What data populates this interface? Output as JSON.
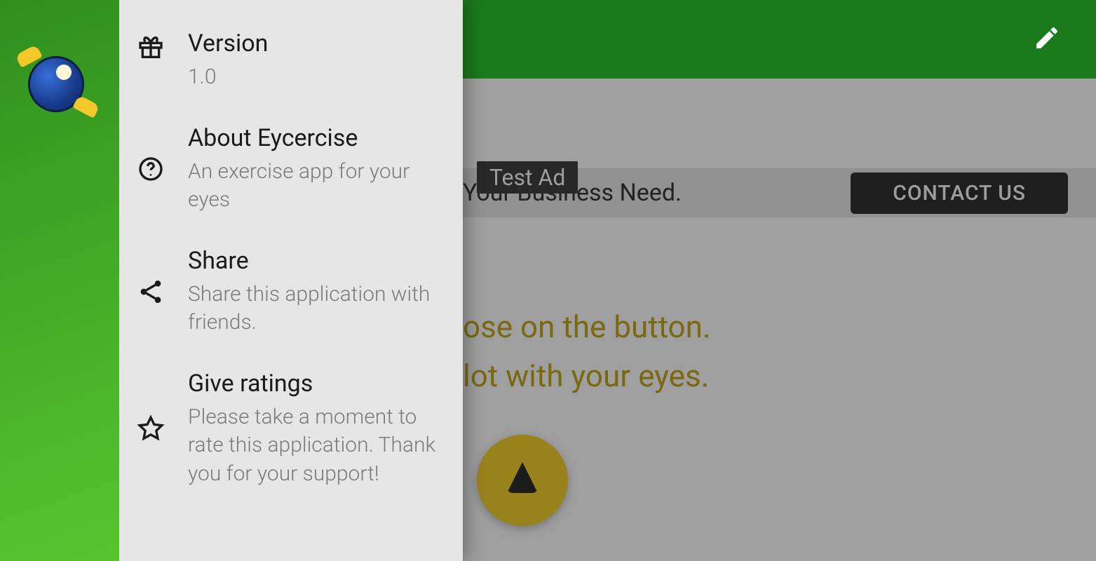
{
  "header": {
    "edit_icon_name": "edit-pencil-icon"
  },
  "ad": {
    "badge": "Test Ad",
    "text_fragment": "Your Business Need.",
    "cta": "CONTACT US"
  },
  "main": {
    "line1": "ose on the button.",
    "line2": "lot with your eyes."
  },
  "drawer": {
    "items": [
      {
        "icon": "gift-icon",
        "title": "Version",
        "subtitle": "1.0"
      },
      {
        "icon": "help-circle-icon",
        "title": "About Eycercise",
        "subtitle": "An exercise app for your eyes"
      },
      {
        "icon": "share-icon",
        "title": "Share",
        "subtitle": "Share this application with friends."
      },
      {
        "icon": "star-outline-icon",
        "title": "Give ratings",
        "subtitle": "Please take a moment to rate this application. Thank you for your support!"
      }
    ]
  }
}
